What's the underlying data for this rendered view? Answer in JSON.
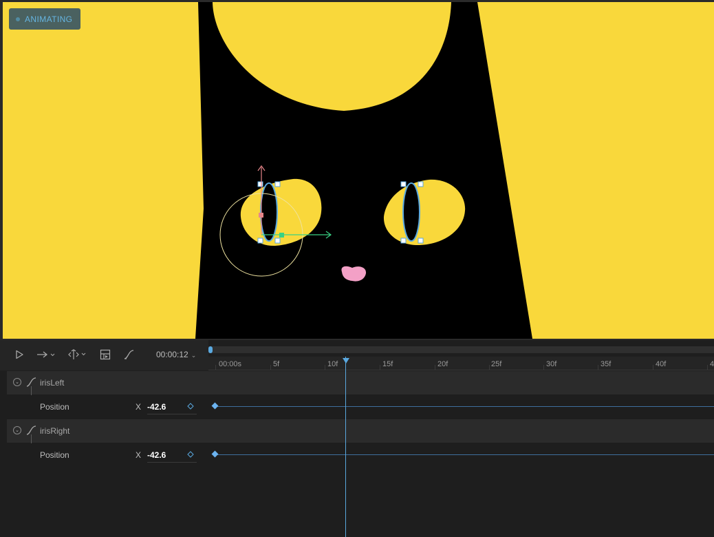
{
  "canvas": {
    "badge_label": "ANIMATING",
    "colors": {
      "background": "#f9d83b",
      "cat_body": "#000000",
      "eye": "#f9d83b",
      "nose": "#f3a0c6",
      "selection": "#5aa9e0",
      "axis_y": "#e7868a",
      "axis_x": "#39d184"
    }
  },
  "toolbar": {
    "icons": [
      "play-icon",
      "loop-arrow-icon",
      "direction-icon",
      "record-icon",
      "curve-icon"
    ],
    "time": "00:00:12"
  },
  "timeline": {
    "ruler_labels": [
      "00:00s",
      "5f",
      "10f",
      "15f",
      "20f",
      "25f",
      "30f",
      "35f",
      "40f",
      "4"
    ],
    "playhead_frame": 12,
    "groups": [
      {
        "name": "irisLeft",
        "properties": [
          {
            "label": "Position",
            "axis": "X",
            "value": "-42.6"
          }
        ]
      },
      {
        "name": "irisRight",
        "properties": [
          {
            "label": "Position",
            "axis": "X",
            "value": "-42.6"
          }
        ]
      }
    ]
  }
}
